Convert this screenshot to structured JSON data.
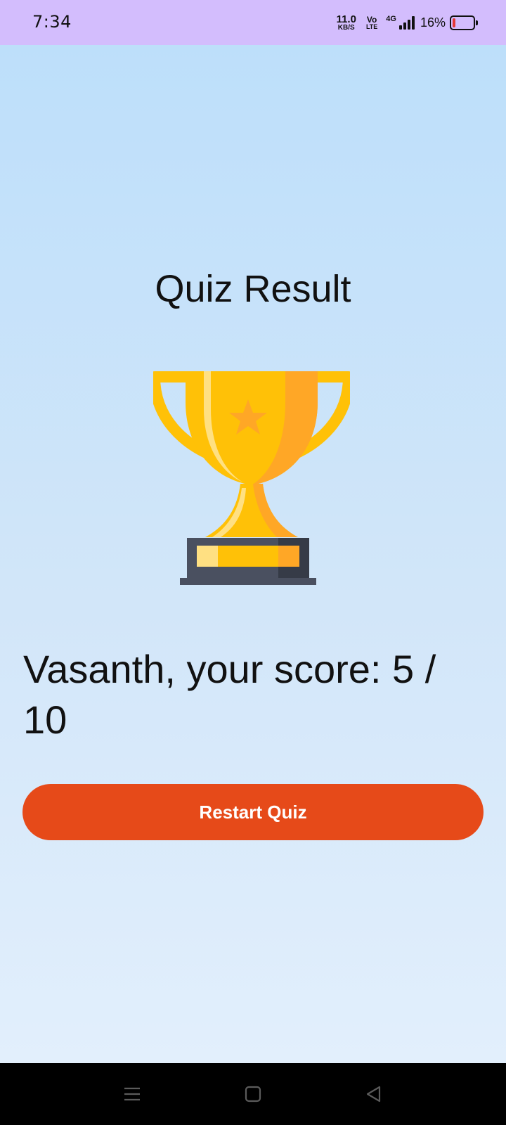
{
  "status_bar": {
    "time": "7:34",
    "net_speed_value": "11.0",
    "net_speed_unit": "KB/S",
    "volte_top": "Vo",
    "volte_bottom": "LTE",
    "network_type": "4G",
    "battery_percent": "16%",
    "battery_level": 0.16,
    "icons": [
      "volte-icon",
      "signal-icon",
      "battery-icon"
    ]
  },
  "main": {
    "title": "Quiz Result",
    "trophy_icon": "trophy-icon",
    "score_text": "Vasanth, your score: 5 / 10",
    "restart_button_label": "Restart Quiz"
  },
  "nav_bar": {
    "icons": [
      "menu-icon",
      "home-icon",
      "back-icon"
    ]
  },
  "colors": {
    "status_bar_bg": "#d3bdfd",
    "background_top": "#bddffa",
    "background_bottom": "#e2effc",
    "accent_button": "#e64a19",
    "trophy_gold": "#ffc107",
    "trophy_orange": "#ffa726",
    "trophy_base": "#4a5060"
  }
}
